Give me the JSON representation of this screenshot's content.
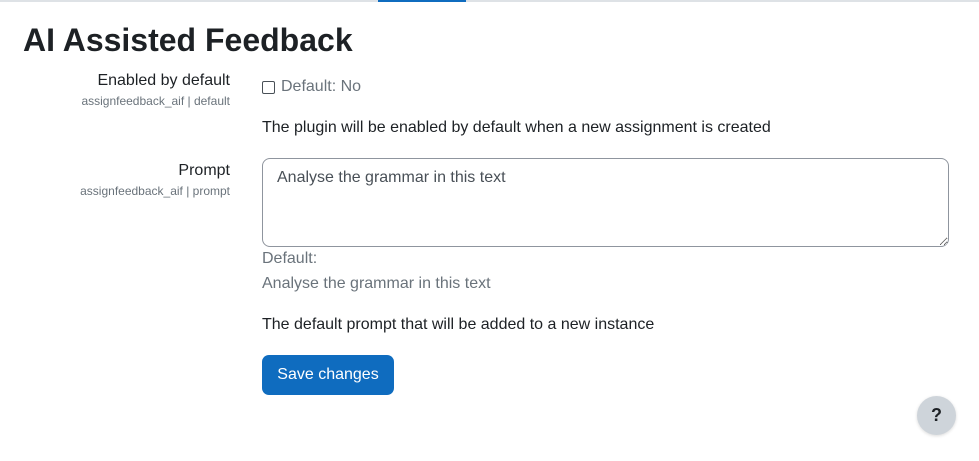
{
  "page": {
    "title": "AI Assisted Feedback"
  },
  "settings": {
    "enabled": {
      "label": "Enabled by default",
      "key": "assignfeedback_aif | default",
      "checked": false,
      "default_text": "Default: No",
      "description": "The plugin will be enabled by default when a new assignment is created"
    },
    "prompt": {
      "label": "Prompt",
      "key": "assignfeedback_aif | prompt",
      "value": "Analyse the grammar in this text",
      "default_label": "Default:",
      "default_value": "Analyse the grammar in this text",
      "description": "The default prompt that will be added to a new instance"
    }
  },
  "actions": {
    "save_label": "Save changes",
    "help_label": "?"
  },
  "colors": {
    "primary": "#0f6cbf",
    "muted": "#6a737b",
    "text": "#1d2125",
    "help_bg": "#ced4da"
  },
  "icons": {
    "help": "question-mark-icon"
  }
}
